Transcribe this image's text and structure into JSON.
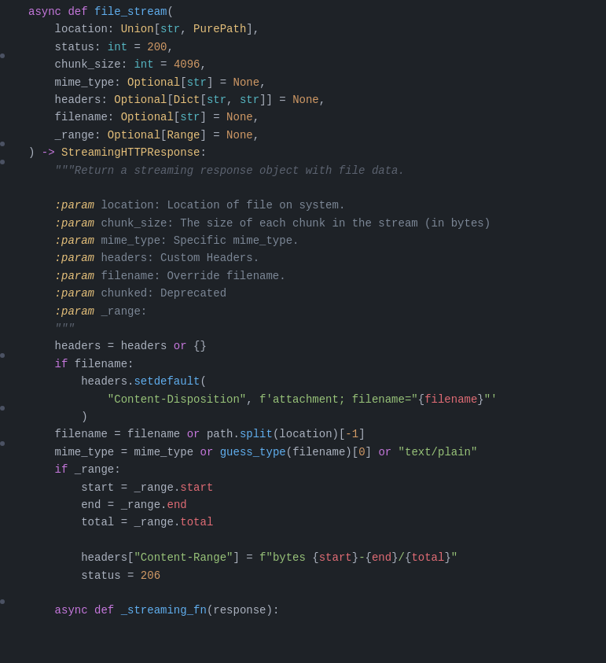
{
  "code": {
    "background": "#1e2227",
    "lines": [
      {
        "num": "",
        "content": "async_def_file_stream",
        "raw": "async def file_stream(",
        "tokens": [
          {
            "text": "async",
            "cls": "kw-async"
          },
          {
            "text": " ",
            "cls": ""
          },
          {
            "text": "def",
            "cls": "kw-def"
          },
          {
            "text": " ",
            "cls": ""
          },
          {
            "text": "file_stream",
            "cls": "fn-name"
          },
          {
            "text": "(",
            "cls": "punctuation"
          }
        ]
      },
      {
        "num": "",
        "raw": "    location: Union[str, PurePath],"
      },
      {
        "num": "",
        "raw": "    status: int = 200,"
      },
      {
        "num": "",
        "raw": "    chunk_size: int = 4096,"
      },
      {
        "num": "",
        "raw": "    mime_type: Optional[str] = None,"
      },
      {
        "num": "",
        "raw": "    headers: Optional[Dict[str, str]] = None,"
      },
      {
        "num": "",
        "raw": "    filename: Optional[str] = None,"
      },
      {
        "num": "",
        "raw": "    _range: Optional[Range] = None,"
      },
      {
        "num": "",
        "raw": ") -> StreamingHTTPResponse:"
      },
      {
        "num": "",
        "raw": "    \"\"\"Return a streaming response object with file data."
      },
      {
        "num": "",
        "raw": ""
      },
      {
        "num": "",
        "raw": "    :param location: Location of file on system."
      },
      {
        "num": "",
        "raw": "    :param chunk_size: The size of each chunk in the stream (in bytes)"
      },
      {
        "num": "",
        "raw": "    :param mime_type: Specific mime_type."
      },
      {
        "num": "",
        "raw": "    :param headers: Custom Headers."
      },
      {
        "num": "",
        "raw": "    :param filename: Override filename."
      },
      {
        "num": "",
        "raw": "    :param chunked: Deprecated"
      },
      {
        "num": "",
        "raw": "    :param _range:"
      },
      {
        "num": "",
        "raw": "    \"\"\""
      },
      {
        "num": "",
        "raw": "    headers = headers or {}"
      },
      {
        "num": "",
        "raw": "    if filename:"
      },
      {
        "num": "",
        "raw": "        headers.setdefault("
      },
      {
        "num": "",
        "raw": "            \"Content-Disposition\", f'attachment; filename=\"{filename}\"'"
      },
      {
        "num": "",
        "raw": "        )"
      },
      {
        "num": "",
        "raw": "    filename = filename or path.split(location)[-1]"
      },
      {
        "num": "",
        "raw": "    mime_type = mime_type or guess_type(filename)[0] or \"text/plain\""
      },
      {
        "num": "",
        "raw": "    if _range:"
      },
      {
        "num": "",
        "raw": "        start = _range.start"
      },
      {
        "num": "",
        "raw": "        end = _range.end"
      },
      {
        "num": "",
        "raw": "        total = _range.total"
      },
      {
        "num": "",
        "raw": ""
      },
      {
        "num": "",
        "raw": "        headers[\"Content-Range\"] = f\"bytes {start}-{end}/{total}\""
      },
      {
        "num": "",
        "raw": "        status = 206"
      },
      {
        "num": "",
        "raw": ""
      },
      {
        "num": "",
        "raw": "    async def _streaming_fn(response):"
      }
    ]
  }
}
